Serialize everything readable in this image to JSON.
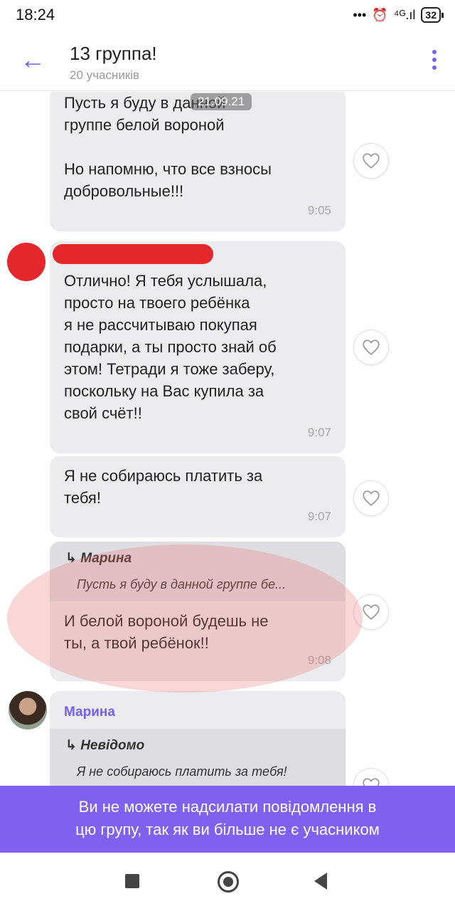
{
  "status": {
    "time": "18:24",
    "dots": "•••",
    "alarm": "⏰",
    "signal": "⁴ᴳ.ıl",
    "battery": "32"
  },
  "header": {
    "back_icon": "←",
    "title": "13 группа!",
    "subtitle": "20 учасників"
  },
  "chat": {
    "date_chip": "21.09.21",
    "messages": [
      {
        "text": "Пусть  я буду  в данной\nгруппе  белой  вороной\n\nНо напомню,  что  все взносы\nдобровольные!!!",
        "time": "9:05"
      },
      {
        "text": "Отлично! Я тебя услышала,\nпросто на твоего ребёнка\nя не рассчитываю покупая\nподарки, а ты просто знай об\nэтом! Тетради я тоже заберу,\nпоскольку на Вас купила за\nсвой счёт!!",
        "time": "9:07"
      },
      {
        "text": "Я не собираюсь платить за\nтебя!",
        "time": "9:07"
      },
      {
        "reply_name": "Марина",
        "reply_text": "Пусть  я буду  в данной  группе  бе...",
        "text": "И белой вороной будешь не\nты, а твой ребёнок!!",
        "time": "9:08"
      },
      {
        "sender": "Марина",
        "reply_name": "Невідомо",
        "reply_text": "Я не собираюсь платить за тебя!"
      }
    ]
  },
  "banner": {
    "text": "Ви не можете надсилати повідомлення в\nцю групу, так як ви більше не є учасником"
  },
  "colors": {
    "accent": "#7360f2",
    "bubble": "#ececef",
    "banner": "#7f61f0",
    "redaction": "#e3272a"
  }
}
